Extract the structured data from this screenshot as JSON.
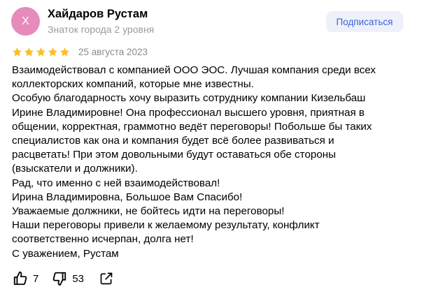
{
  "review": {
    "author": {
      "initial": "Х",
      "name": "Хайдаров Рустам",
      "status": "Знаток города 2 уровня",
      "avatar_color": "#e68bbc"
    },
    "subscribe_label": "Подписаться",
    "rating": 5,
    "date": "25 августа 2023",
    "text_lines": [
      "Взаимодействовал с компанией ООО ЭОС. Лучшая компания среди всех",
      "коллекторских компаний, которые мне известны.",
      "Особую благодарность хочу выразить сотруднику компании Кизельбаш",
      "Ирине Владимировне! Она профессионал высшего уровня, приятная в",
      "общении, корректная, граммотно ведёт переговоры! Побольше бы таких",
      "специалистов как она и компания будет всё более развиваться и",
      "расцветать! При этом довольными будут оставаться обе стороны",
      "(взыскатели и должники).",
      "Рад, что именно с ней взаимодействовал!",
      "Ирина Владимировна, Большое Вам Спасибо!",
      "Уважаемые должники, не бойтесь идти на переговоры!",
      "Наши переговоры привели к желаемому результату, конфликт",
      "соответственно исчерпан, долга нет!",
      "С уважением, Рустам"
    ],
    "likes": "7",
    "dislikes": "53",
    "icons": {
      "star": "star-icon",
      "like": "thumbs-up-icon",
      "dislike": "thumbs-down-icon",
      "share": "share-icon"
    },
    "colors": {
      "star": "#fbbf24",
      "subscribe_text": "#3b63d8",
      "subscribe_bg": "#eef1fa",
      "muted_text": "#9b9b9b"
    }
  }
}
